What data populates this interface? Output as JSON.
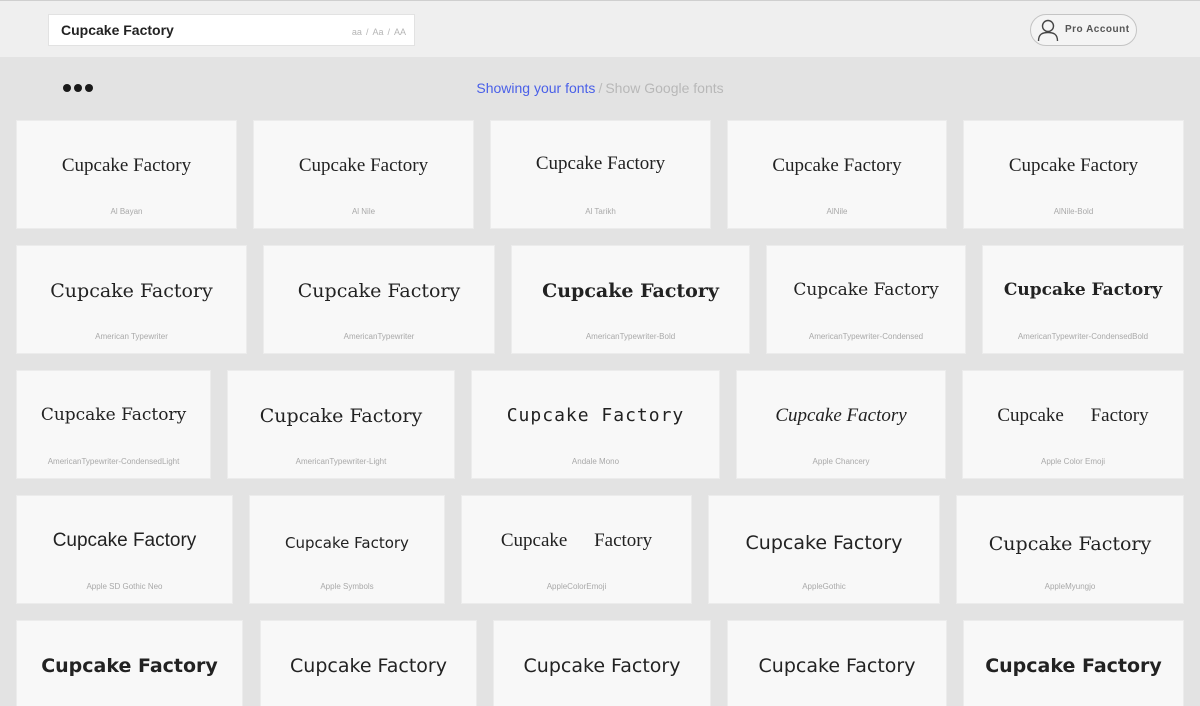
{
  "search": {
    "value": "Cupcake Factory"
  },
  "case_options": [
    "aa",
    "Aa",
    "AA"
  ],
  "account": {
    "label": "Pro Account"
  },
  "source_toggle": {
    "active": "Showing your fonts",
    "separator": "/",
    "inactive": "Show Google fonts"
  },
  "sample_text": "Cupcake Factory",
  "fonts": [
    "Al Bayan",
    "Al Nile",
    "Al Tarikh",
    "AlNile",
    "AlNile-Bold",
    "American Typewriter",
    "AmericanTypewriter",
    "AmericanTypewriter-Bold",
    "AmericanTypewriter-Condensed",
    "AmericanTypewriter-CondensedBold",
    "AmericanTypewriter-CondensedLight",
    "AmericanTypewriter-Light",
    "Andale Mono",
    "Apple Chancery",
    "Apple Color Emoji",
    "Apple SD Gothic Neo",
    "Apple Symbols",
    "AppleColorEmoji",
    "AppleGothic",
    "AppleMyungjo",
    "",
    "",
    "",
    "",
    ""
  ]
}
